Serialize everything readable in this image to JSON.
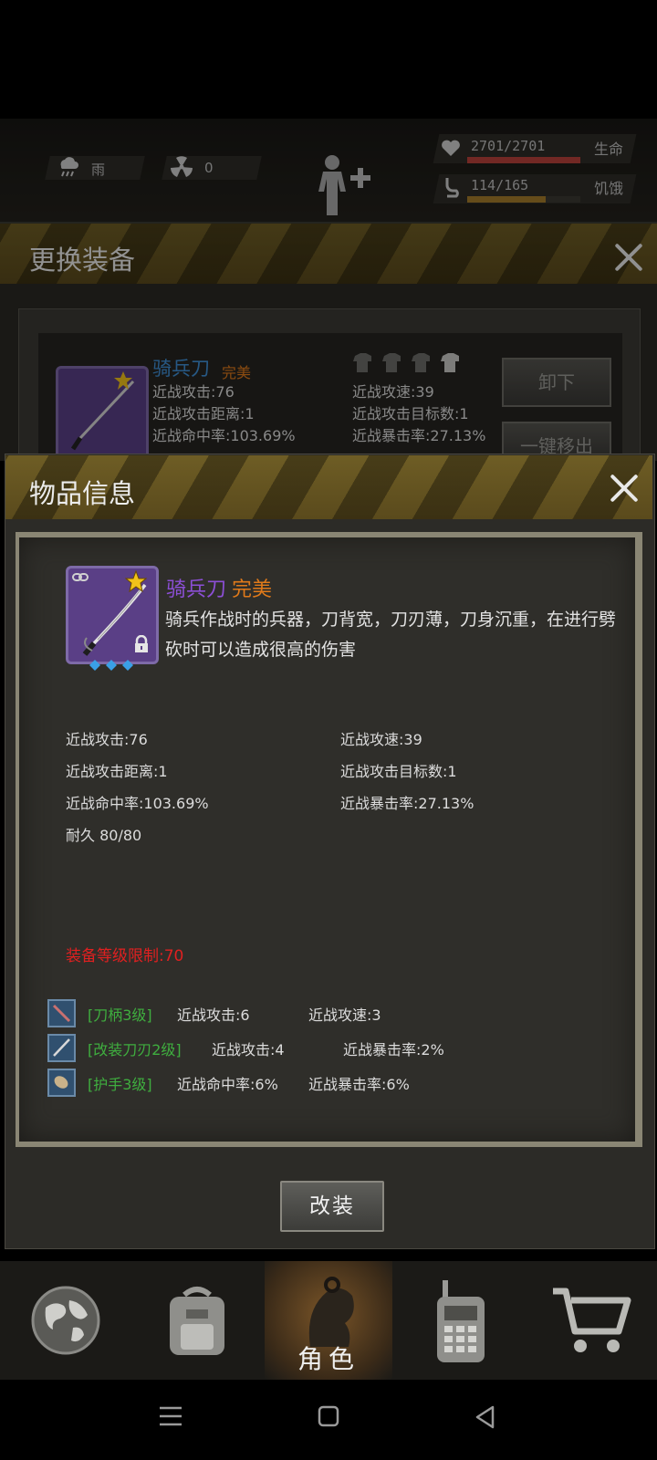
{
  "hud": {
    "weather": "雨",
    "radiation": "0",
    "hp": "2701/2701",
    "hp_label": "生命",
    "hp_fraction": 1.0,
    "hunger": "114/165",
    "hunger_label": "饥饿",
    "hunger_fraction": 0.69
  },
  "back_dialog": {
    "title": "更换装备",
    "item_name": "骑兵刀",
    "item_quality": "完美",
    "stats_left": [
      "近战攻击:76",
      "近战攻击距离:1",
      "近战命中率:103.69%"
    ],
    "stats_right": [
      "近战攻速:39",
      "近战攻击目标数:1",
      "近战暴击率:27.13%"
    ],
    "unequip_label": "卸下",
    "remove_all_label": "一键移出"
  },
  "dialog": {
    "title": "物品信息",
    "item_name": "骑兵刀",
    "item_quality": "完美",
    "description": "骑兵作战时的兵器，刀背宽，刀刃薄，刀身沉重，在进行劈砍时可以造成很高的伤害",
    "stats_left": [
      "近战攻击:76",
      "近战攻击距离:1",
      "近战命中率:103.69%",
      "耐久 80/80"
    ],
    "stats_right": [
      "近战攻速:39",
      "近战攻击目标数:1",
      "近战暴击率:27.13%"
    ],
    "level_req": "装备等级限制:70",
    "mods": [
      {
        "name": "[刀柄3级]",
        "s1": "近战攻击:6",
        "s2": "近战攻速:3",
        "icon": "sword-hilt-icon"
      },
      {
        "name": "[改装刀刃2级]",
        "s1": "近战攻击:4",
        "s2": "近战暴击率:2%",
        "icon": "blade-icon"
      },
      {
        "name": "[护手3级]",
        "s1": "近战命中率:6%",
        "s2": "近战暴击率:6%",
        "icon": "hand-guard-icon"
      }
    ],
    "modify_label": "改装"
  },
  "nav": {
    "items": [
      "world-icon",
      "backpack-icon",
      "character-icon",
      "radio-icon",
      "shop-icon"
    ],
    "active_label": "角色"
  },
  "colors": {
    "item_name": "#8c4fd6",
    "quality": "#e07a1a",
    "mod_green": "#3fae3f",
    "level_red": "#e02020",
    "back_item_name": "#3f8fd6"
  }
}
